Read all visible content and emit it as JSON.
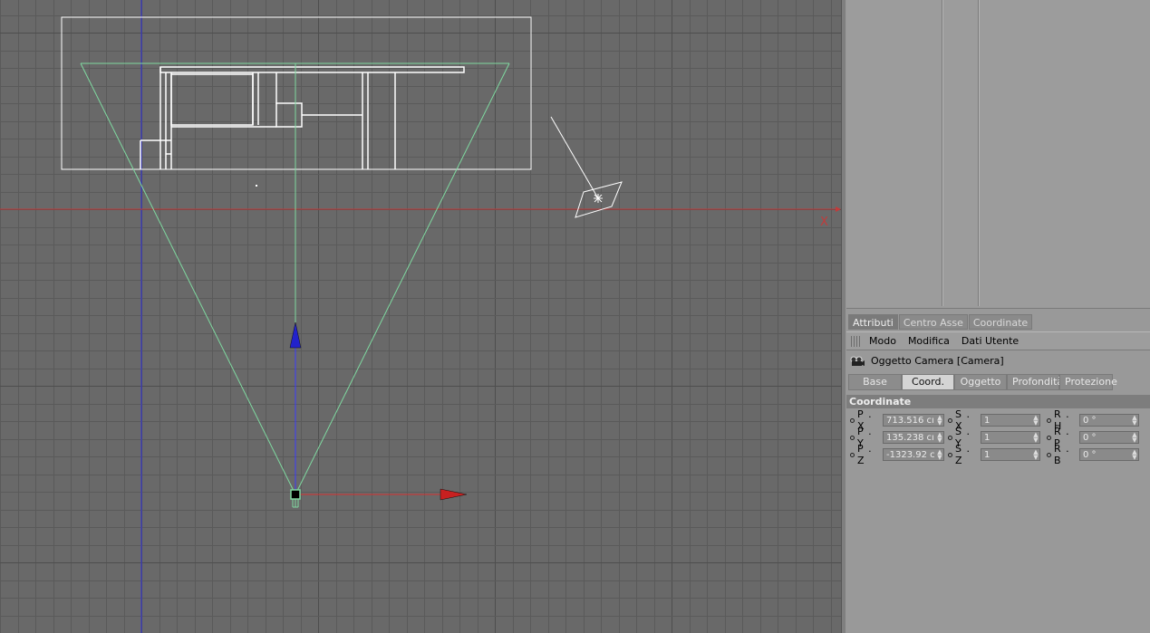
{
  "viewport": {
    "axis_label": "X"
  },
  "manager_tabs": [
    {
      "label": "Attributi",
      "active": true
    },
    {
      "label": "Centro Asse",
      "active": false
    },
    {
      "label": "Coordinate",
      "active": false
    }
  ],
  "menu": [
    "Modo",
    "Modifica",
    "Dati Utente"
  ],
  "object_title": "Oggetto Camera [Camera]",
  "attr_tabs": [
    {
      "label": "Base",
      "active": false
    },
    {
      "label": "Coord.",
      "active": true
    },
    {
      "label": "Oggetto",
      "active": false
    },
    {
      "label": "Profondità",
      "active": false
    },
    {
      "label": "Protezione",
      "active": false
    }
  ],
  "section": "Coordinate",
  "coords": {
    "px": {
      "label": "P . X",
      "value": "713.516 cı"
    },
    "py": {
      "label": "P . Y",
      "value": "135.238 cı"
    },
    "pz": {
      "label": "P . Z",
      "value": "-1323.92 c"
    },
    "sx": {
      "label": "S . X",
      "value": "1"
    },
    "sy": {
      "label": "S . Y",
      "value": "1"
    },
    "sz": {
      "label": "S . Z",
      "value": "1"
    },
    "rh": {
      "label": "R . H",
      "value": "0 °"
    },
    "rp": {
      "label": "R . P",
      "value": "0 °"
    },
    "rb": {
      "label": "R . B",
      "value": "0 °"
    }
  },
  "colors": {
    "grid_bg": "#696969",
    "x_axis": "#c23b3b",
    "z_axis": "#2e2ee0",
    "frustum": "#7fd9a0",
    "wire": "#ffffff"
  }
}
